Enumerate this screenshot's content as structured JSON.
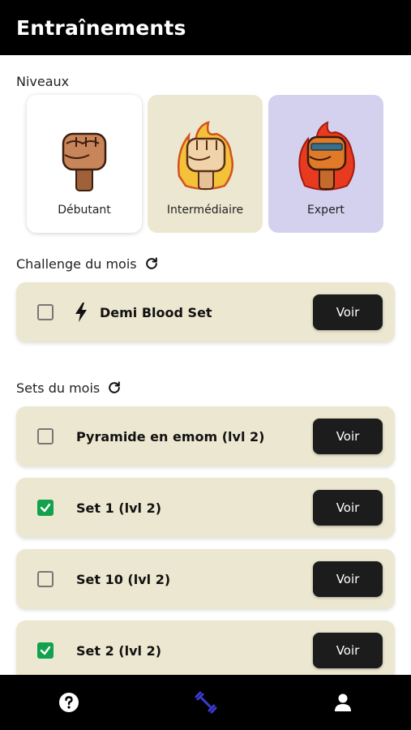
{
  "header": {
    "title": "Entraînements"
  },
  "levels_section": {
    "title": "Niveaux",
    "levels": [
      {
        "label": "Débutant",
        "icon": "fist-icon"
      },
      {
        "label": "Intermédiaire",
        "icon": "flaming-fist-icon"
      },
      {
        "label": "Expert",
        "icon": "fire-fist-icon"
      }
    ]
  },
  "challenge_section": {
    "title": "Challenge du mois",
    "item": {
      "name": "Demi Blood Set",
      "checked": false,
      "icon": "bolt-icon",
      "button_label": "Voir"
    }
  },
  "sets_section": {
    "title": "Sets du mois",
    "items": [
      {
        "name": "Pyramide en emom (lvl 2)",
        "checked": false,
        "button_label": "Voir"
      },
      {
        "name": "Set 1 (lvl 2)",
        "checked": true,
        "button_label": "Voir"
      },
      {
        "name": "Set 10 (lvl 2)",
        "checked": false,
        "button_label": "Voir"
      },
      {
        "name": "Set 2 (lvl 2)",
        "checked": true,
        "button_label": "Voir"
      }
    ]
  },
  "bottom_nav": {
    "items": [
      {
        "icon": "help-icon",
        "active": false
      },
      {
        "icon": "dumbbell-icon",
        "active": true
      },
      {
        "icon": "user-icon",
        "active": false
      }
    ],
    "active_color": "#3b3bd6"
  },
  "colors": {
    "card_beige": "#ece7d0",
    "card_lavender": "#d3d1ee",
    "check_green": "#12a14c",
    "button_dark": "#1c1c1c"
  }
}
